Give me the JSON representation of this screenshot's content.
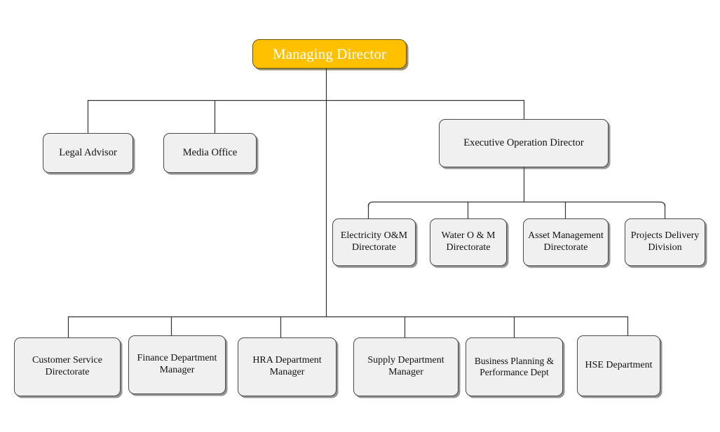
{
  "chart": {
    "type": "org-chart",
    "title": "Managing Director",
    "background_color": "#ffffff",
    "root_fill_color": "#ffc000",
    "root_text_color": "#ffffff",
    "node_fill_color": "#f0f0f0",
    "node_border_color": "#4a4a4a",
    "connector_color": "#333333"
  },
  "nodes": {
    "root": {
      "label": "Managing Director"
    },
    "legal_advisor": {
      "label": "Legal Advisor"
    },
    "media_office": {
      "label": "Media Office"
    },
    "executive_operation_director": {
      "label": "Executive Operation Director"
    },
    "electricity_om": {
      "label": "Electricity O&M Directorate"
    },
    "water_om": {
      "label": "Water O & M Directorate"
    },
    "asset_management": {
      "label": "Asset Management Directorate"
    },
    "projects_delivery": {
      "label": "Projects Delivery Division"
    },
    "customer_service": {
      "label": "Customer Service Directorate"
    },
    "finance_department": {
      "label": "Finance Department Manager"
    },
    "hra_department": {
      "label": "HRA Department Manager"
    },
    "supply_department": {
      "label": "Supply Department Manager"
    },
    "business_planning": {
      "label": "Business Planning & Performance Dept"
    },
    "hse_department": {
      "label": "HSE Department"
    }
  }
}
